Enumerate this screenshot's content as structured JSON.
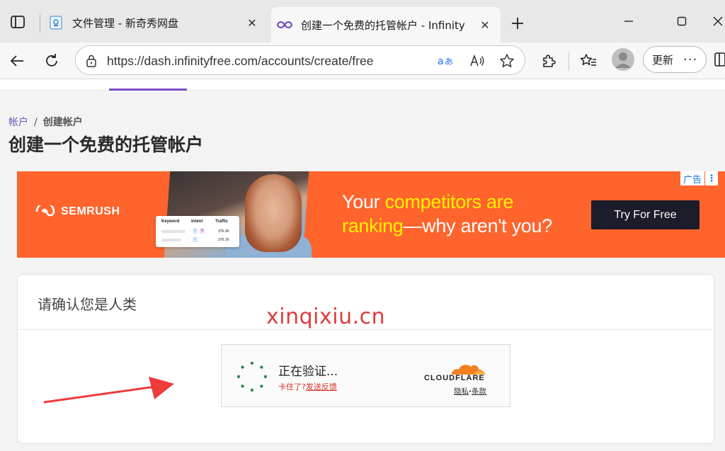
{
  "tabs": [
    {
      "title": "文件管理 - 新奇秀网盘",
      "favicon": "file-manager-icon",
      "active": false
    },
    {
      "title": "创建一个免费的托管帐户 - Infinity",
      "favicon": "infinity-icon",
      "active": true
    }
  ],
  "toolbar": {
    "url": "https://dash.infinityfree.com/accounts/create/free",
    "update_label": "更新",
    "more_label": "···"
  },
  "page": {
    "breadcrumb": {
      "parent": "帐户",
      "separator": "/",
      "current": "创建帐户"
    },
    "title": "创建一个免费的托管帐户"
  },
  "ad": {
    "brand": "SEMRUSH",
    "headline_line1_prefix": "Your ",
    "headline_line1_highlight": "competitors are",
    "headline_line2_highlight": "ranking",
    "headline_line2_rest": "—why aren't you?",
    "cta": "Try For Free",
    "badge": "广告",
    "card": {
      "col_keyword": "Keyword",
      "col_intent": "Intent",
      "col_traffic": "Traffic",
      "row1_traffic": "376.3K",
      "row2_traffic": "376.1K"
    },
    "colors": {
      "background": "#ff642d",
      "highlight": "#fff200",
      "cta_bg": "#1c1c2a"
    }
  },
  "verify": {
    "title": "请确认您是人类",
    "status": "正在验证...",
    "stuck": "卡住了?",
    "feedback": "发送反馈",
    "brand": "CLOUDFLARE",
    "privacy": "隐私",
    "dot": "·",
    "terms": "条款"
  },
  "watermark": "xinqixiu.cn"
}
